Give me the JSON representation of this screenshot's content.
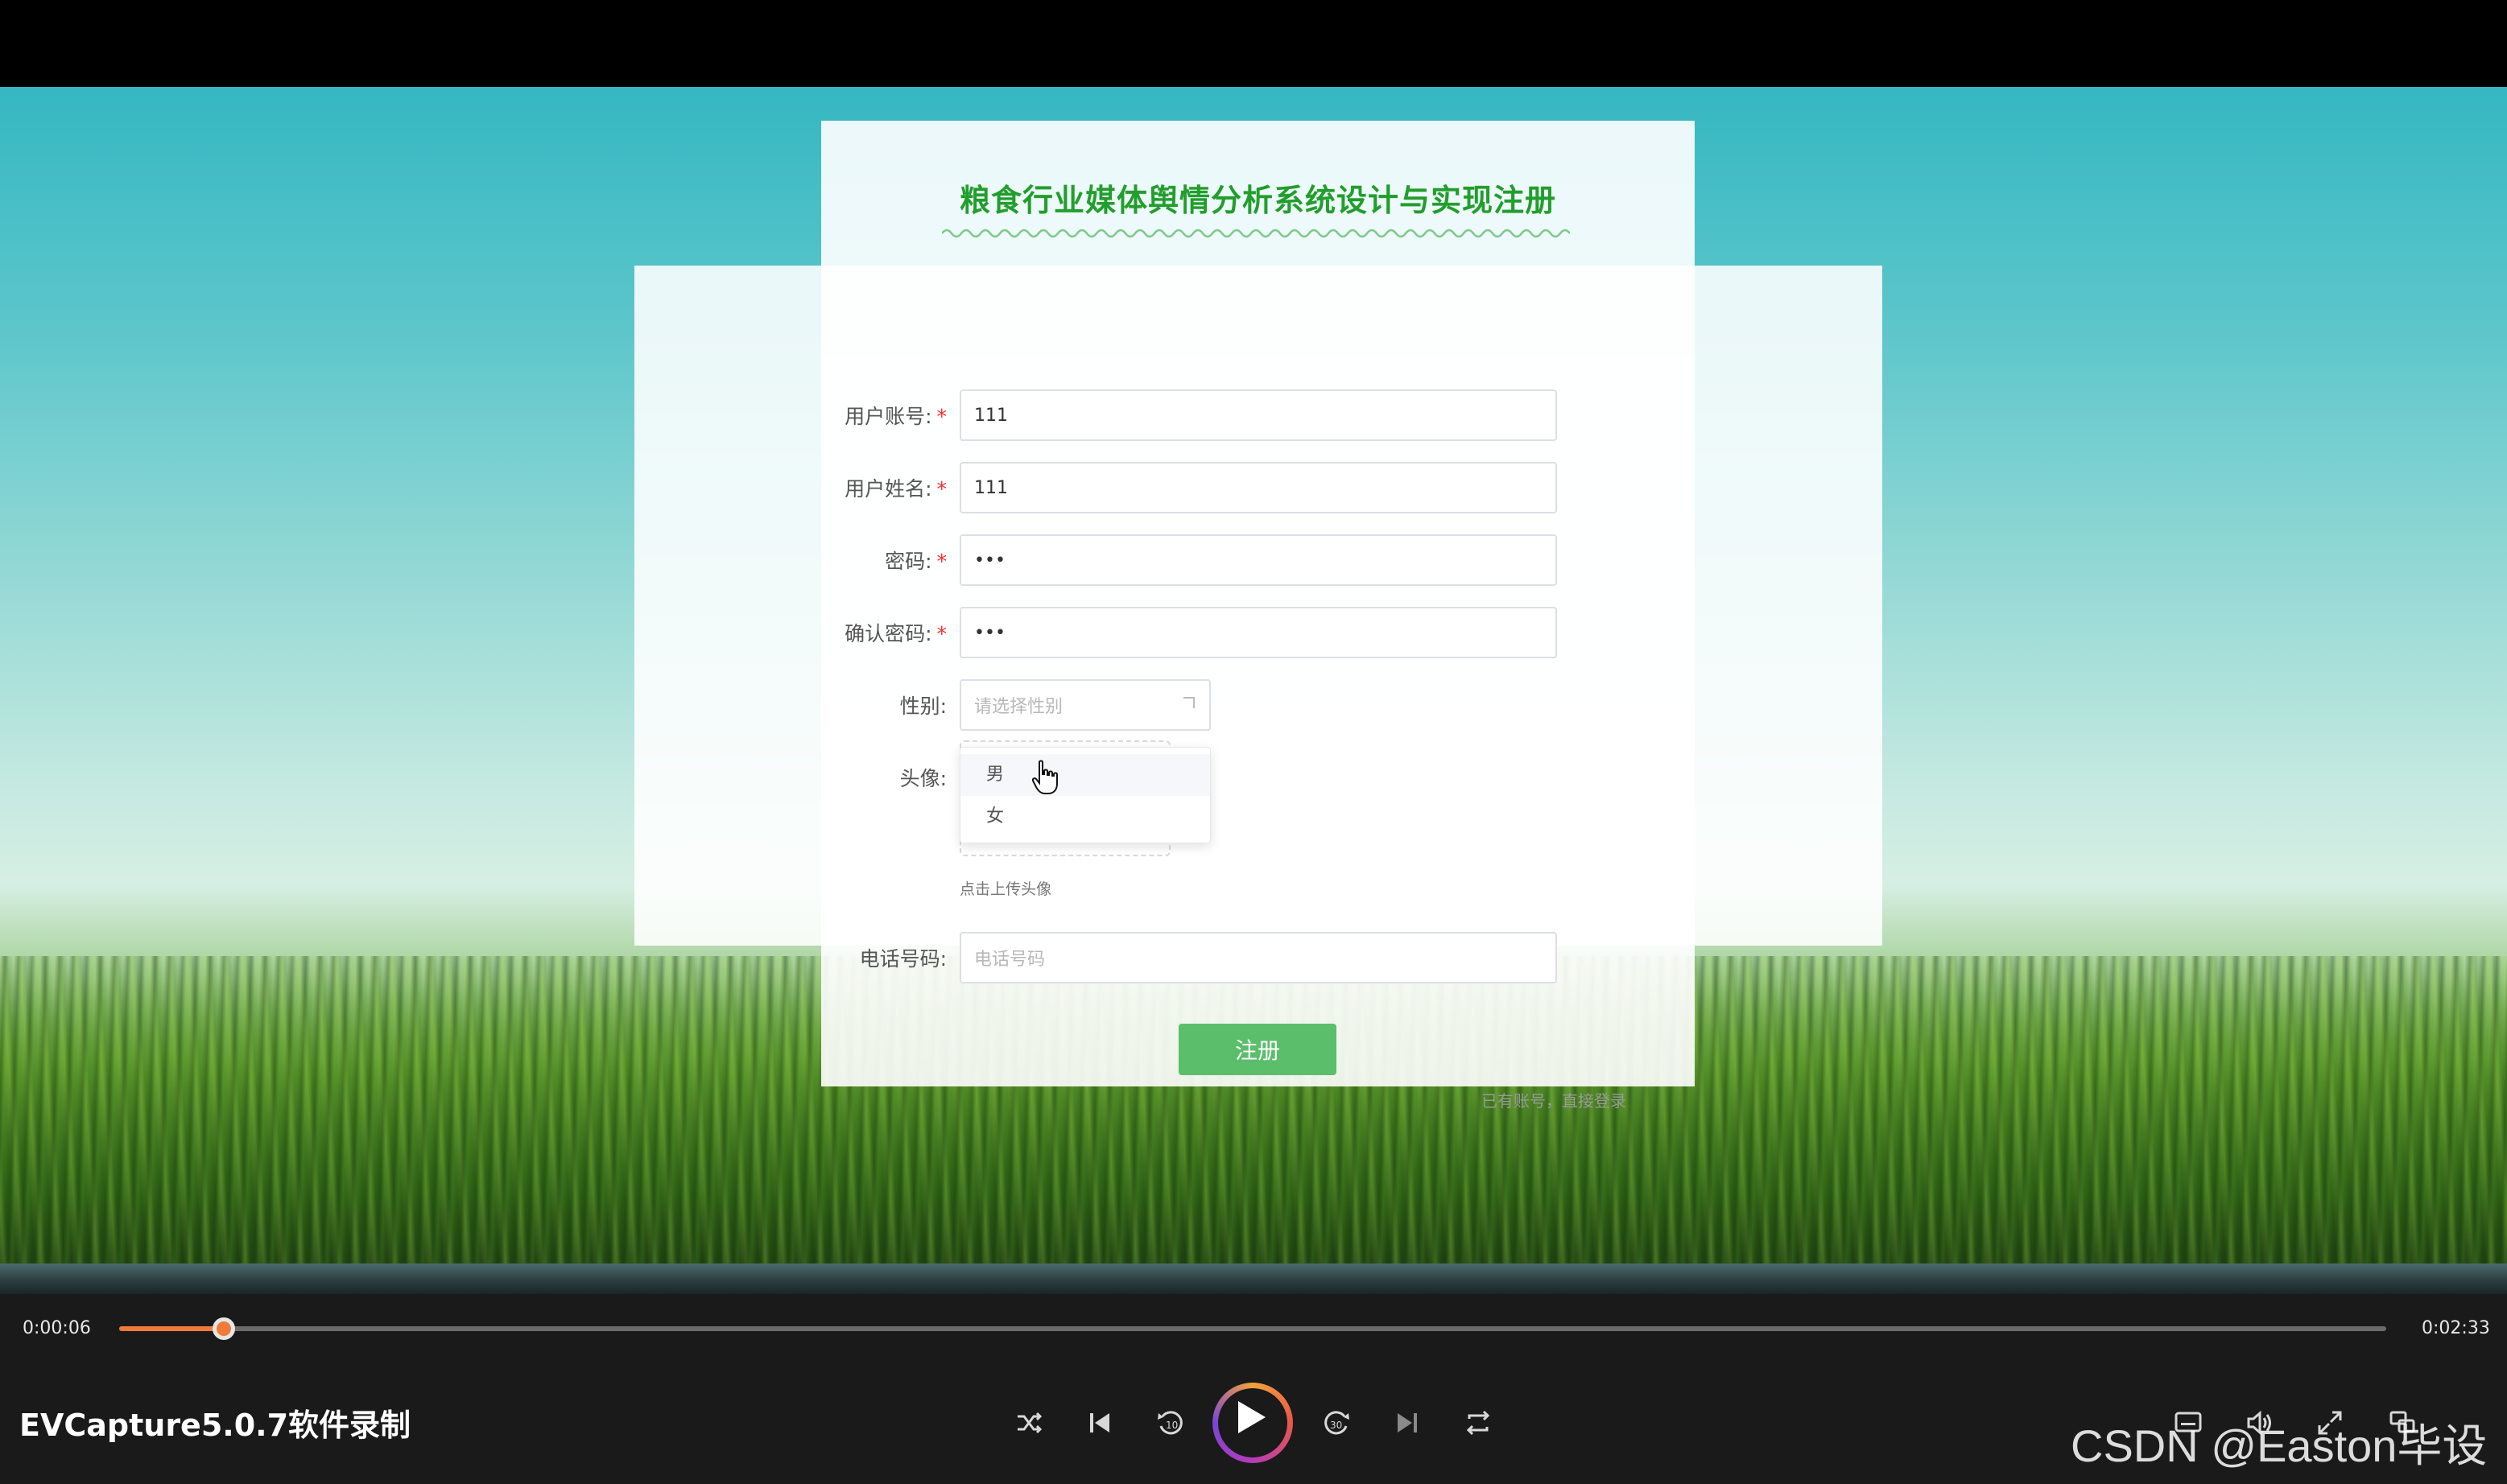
{
  "page": {
    "title": "粮食行业媒体舆情分析系统设计与实现注册"
  },
  "form": {
    "account_label": "用户账号:",
    "account_value": "111",
    "name_label": "用户姓名:",
    "name_value": "111",
    "password_label": "密码:",
    "password_value": "•••",
    "confirm_label": "确认密码:",
    "confirm_value": "•••",
    "gender_label": "性别:",
    "gender_placeholder": "请选择性别",
    "gender_options": [
      "男",
      "女"
    ],
    "avatar_label": "头像:",
    "avatar_hint": "点击上传头像",
    "phone_label": "电话号码:",
    "phone_placeholder": "电话号码",
    "required_mark": "*",
    "submit_label": "注册",
    "login_link": "已有账号，直接登录"
  },
  "player": {
    "current_time": "0:00:06",
    "total_time": "0:02:33",
    "progress_fraction": 0.046,
    "app_name": "EVCapture5.0.7软件录制",
    "watermark": "CSDN @Easton毕设",
    "icons": [
      "shuffle-icon",
      "previous-icon",
      "rewind-10-icon",
      "play-icon",
      "forward-30-icon",
      "next-icon",
      "repeat-icon",
      "subtitles-icon",
      "volume-icon",
      "fullscreen-icon",
      "mini-player-icon"
    ],
    "accent_color": "#f07a3a"
  }
}
